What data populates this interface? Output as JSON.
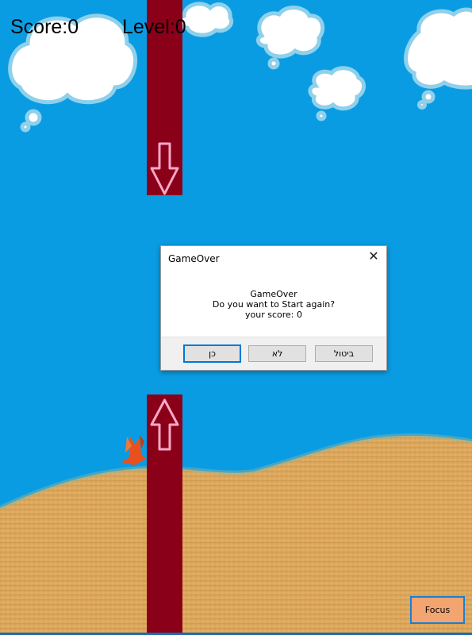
{
  "hud": {
    "score_text": "Score:0",
    "level_text": "Level:0"
  },
  "dialog": {
    "title": "GameOver",
    "close_symbol": "✕",
    "message_line1": "GameOver",
    "message_line2": "Do you want to Start again?",
    "message_line3": "your score: 0",
    "yes_label": "כן",
    "no_label": "לא",
    "cancel_label": "ביטול"
  },
  "focus_button": {
    "label": "Focus"
  },
  "colors": {
    "sky": "#0a9ce3",
    "pipe": "#8b0019",
    "arrow": "#f7a8c6",
    "sand": "#e0a85a",
    "cloud_outline": "#8fd0ea"
  },
  "icons": [
    "down-arrow-icon",
    "up-arrow-icon",
    "close-icon",
    "bird-sprite"
  ]
}
